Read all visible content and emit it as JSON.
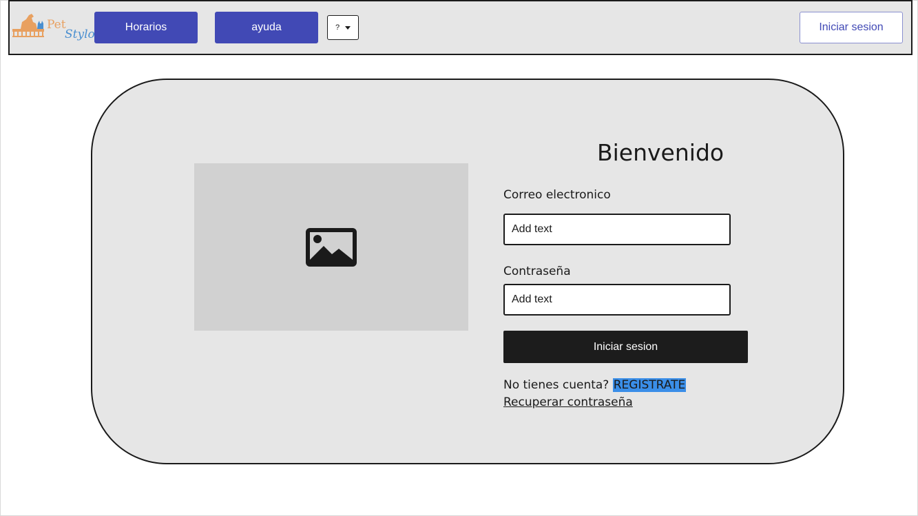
{
  "header": {
    "logo": {
      "pet_text": "Pet",
      "stylo_text": "Stylo"
    },
    "nav": {
      "horarios_label": "Horarios",
      "ayuda_label": "ayuda",
      "help_dropdown_value": "?"
    },
    "login_label": "Iniciar sesion"
  },
  "login_card": {
    "title": "Bienvenido",
    "email": {
      "label": "Correo electronico",
      "placeholder": "Add text"
    },
    "password": {
      "label": "Contraseña",
      "placeholder": "Add text"
    },
    "submit_label": "Iniciar sesion",
    "signup_prompt": "No tienes cuenta?",
    "register_label": "REGISTRATE",
    "recover_label": "Recuperar contraseña"
  },
  "icons": {
    "image_placeholder": "image-icon",
    "dropdown": "chevron-down-icon",
    "logo": "pet-grooming-logo"
  },
  "colors": {
    "nav_button": "#4149b5",
    "card_background": "#e6e6e6",
    "submit_button": "#1c1c1c",
    "register_highlight": "#3a8ee8",
    "placeholder_bg": "#d1d1d1"
  }
}
